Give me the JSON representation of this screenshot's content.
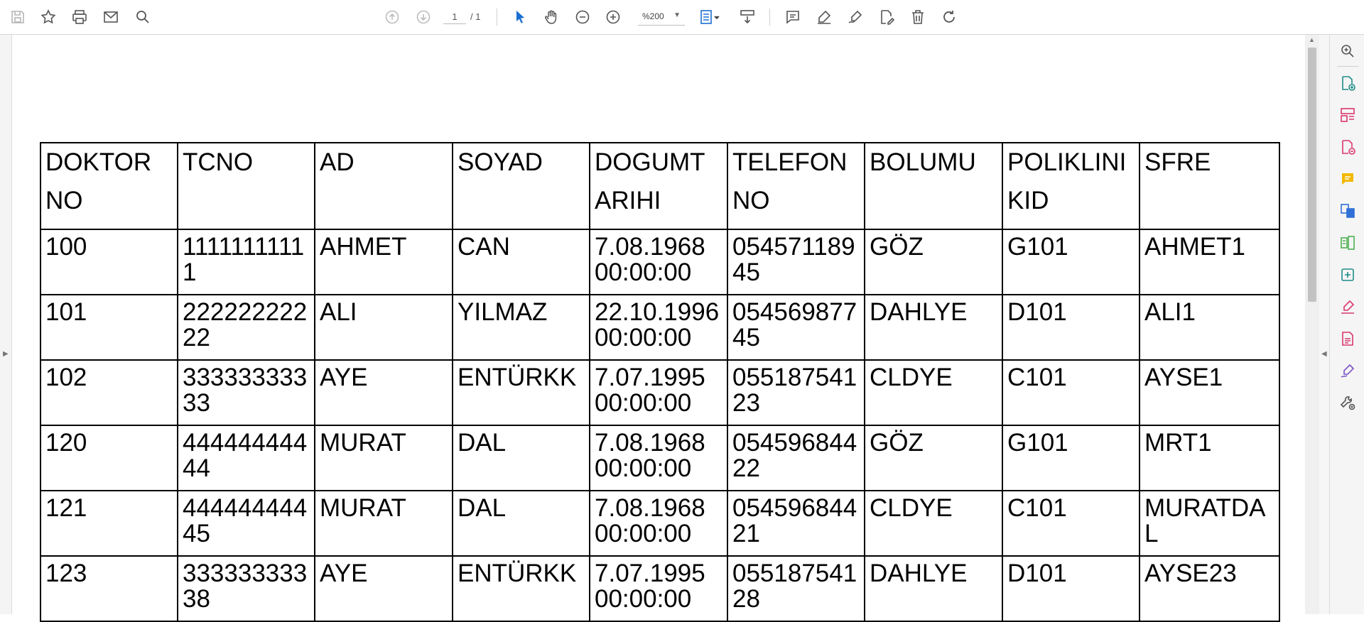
{
  "toolbar": {
    "page_current": "1",
    "page_total": "/ 1",
    "zoom": "%200",
    "icons": [
      "save-icon",
      "star-icon",
      "print-icon",
      "mail-icon",
      "search-icon",
      "prev-page-icon",
      "next-page-icon",
      "select-cursor-icon",
      "hand-icon",
      "zoom-out-icon",
      "zoom-in-icon",
      "fit-page-icon",
      "scroll-mode-icon",
      "comment-icon",
      "highlight-icon",
      "sign-icon",
      "edit-icon",
      "delete-icon",
      "rotate-icon"
    ]
  },
  "right_panel": {
    "icons": [
      "zoom-tool-icon",
      "create-pdf-icon",
      "organize-pages-icon",
      "export-pdf-icon",
      "comment-tool-icon",
      "combine-files-icon",
      "compress-icon",
      "scan-icon",
      "fill-sign-icon",
      "protect-icon",
      "request-signature-icon",
      "more-tools-icon"
    ]
  },
  "table": {
    "headers": [
      "DOKTOR NO",
      "TCNO",
      "AD",
      "SOYAD",
      "DOGUMT ARIHI",
      "TELEFON NO",
      "BOLUMU",
      "POLIKLINI KID",
      "SFRE"
    ],
    "rows": [
      [
        "100",
        "11111111111",
        "AHMET",
        "CAN",
        "7.08.1968 00:00:00",
        "05457118945",
        "GÖZ",
        "G101",
        "AHMET1"
      ],
      [
        "101",
        "22222222222",
        "ALI",
        "YILMAZ",
        "22.10.1996 00:00:00",
        "05456987745",
        "DAHLYE",
        "D101",
        "ALI1"
      ],
      [
        "102",
        "33333333333",
        "AYE",
        "ENTÜRKK",
        "7.07.1995 00:00:00",
        "05518754123",
        "CLDYE",
        "C101",
        "AYSE1"
      ],
      [
        "120",
        "44444444444",
        "MURAT",
        "DAL",
        "7.08.1968 00:00:00",
        "05459684422",
        "GÖZ",
        "G101",
        "MRT1"
      ],
      [
        "121",
        "44444444445",
        "MURAT",
        "DAL",
        "7.08.1968 00:00:00",
        "05459684421",
        "CLDYE",
        "C101",
        "MURATDAL"
      ],
      [
        "123",
        "33333333338",
        "AYE",
        "ENTÜRKK",
        "7.07.1995 00:00:00",
        "05518754128",
        "DAHLYE",
        "D101",
        "AYSE23"
      ]
    ]
  }
}
